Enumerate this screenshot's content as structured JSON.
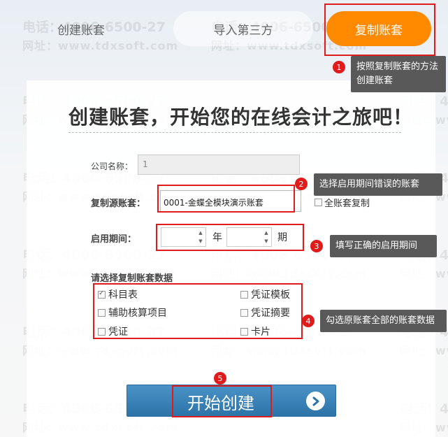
{
  "tabs": [
    {
      "label": "创建账套"
    },
    {
      "label": "导入第三方"
    },
    {
      "label": "复制账套"
    }
  ],
  "watermark": {
    "line1": "电话：4006-6500-27",
    "line2": "网址：www.tdxsoft.com"
  },
  "page_title": "创建账套，开始您的在线会计之旅吧！",
  "form": {
    "company_label": "公司名称：",
    "company_value": "1",
    "source_label": "复制源账套：",
    "source_value": "0001-金蝶全模块演示账套",
    "all_copy_label": "全账套复制",
    "period_label": "启用期间：",
    "year_unit": "年",
    "period_unit": "期",
    "select_label": "请选择复制账套数据",
    "options": [
      {
        "label": "科目表",
        "checked": true
      },
      {
        "label": "凭证模板",
        "checked": false
      },
      {
        "label": "辅助核算项目",
        "checked": false
      },
      {
        "label": "凭证摘要",
        "checked": false
      },
      {
        "label": "凭证",
        "checked": false
      },
      {
        "label": "卡片",
        "checked": false
      }
    ]
  },
  "start_button": {
    "label": "开始创建"
  },
  "annotations": [
    {
      "num": "1",
      "text": "按照复制账套的方法创建账套"
    },
    {
      "num": "2",
      "text": "选择启用期间错误的账套"
    },
    {
      "num": "3",
      "text": "填写正确的启用期间"
    },
    {
      "num": "4",
      "text": "勾选原账套全部的账套数据"
    },
    {
      "num": "5",
      "text": ""
    }
  ],
  "colors": {
    "accent": "#ff8a00",
    "highlight": "#e01b1b",
    "button": "#2c73a8"
  }
}
